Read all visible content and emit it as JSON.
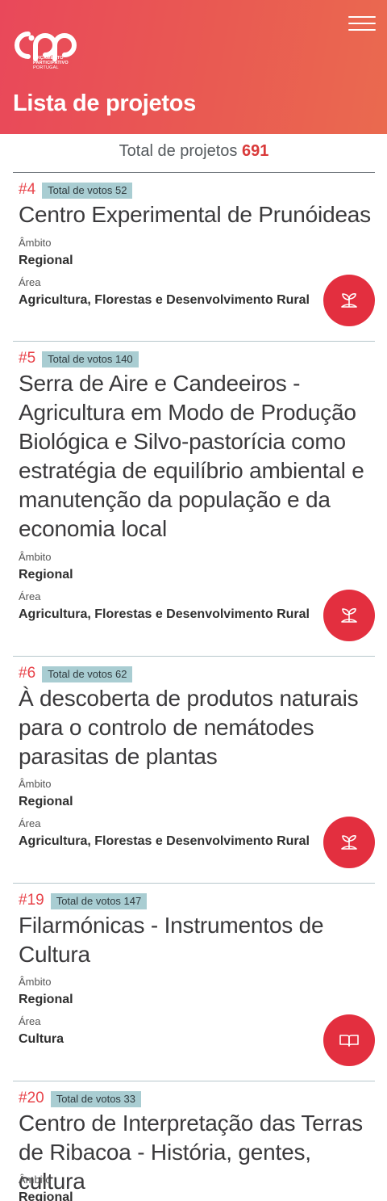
{
  "header": {
    "logo_lines": [
      "ORÇAMENTO",
      "PARTICIPATIVO"
    ],
    "logo_sub": "PORTUGAL",
    "title": "Lista de projetos",
    "menu_icon": "hamburger-icon",
    "logo_icon": "opp-logo"
  },
  "summary": {
    "label": "Total de projetos",
    "count": "691"
  },
  "labels": {
    "ambito": "Âmbito",
    "area": "Área"
  },
  "colors": {
    "accent": "#e32f3f",
    "votes_badge": "#a9cdd2",
    "header_gradient_start": "#e9485a",
    "header_gradient_end": "#ea6a4f"
  },
  "projects": [
    {
      "id": "#4",
      "votes": "Total de votos 52",
      "title_lines": [
        "Centro Experimental de Prunóideas"
      ],
      "ambito_label": "Âmbito",
      "ambito": "Regional",
      "area_label": "Área",
      "area": "Agricultura, Florestas e Desenvolvimento Rural",
      "icon": "sprout-icon"
    },
    {
      "id": "#5",
      "votes": "Total de votos 140",
      "title_lines": [
        "Serra de Aire e Candeeiros -",
        "Agricultura em Modo de Produção",
        "Biológica e Silvo-pastorícia como",
        "estratégia de equilíbrio ambiental e",
        "manutenção da população e da",
        "economia local"
      ],
      "ambito_label": "Âmbito",
      "ambito": "Regional",
      "area_label": "Área",
      "area": "Agricultura, Florestas e Desenvolvimento Rural",
      "icon": "sprout-icon"
    },
    {
      "id": "#6",
      "votes": "Total de votos 62",
      "title_lines": [
        "À descoberta de produtos naturais",
        "para o controlo de nemátodes",
        "parasitas de plantas"
      ],
      "ambito_label": "Âmbito",
      "ambito": "Regional",
      "area_label": "Área",
      "area": "Agricultura, Florestas e Desenvolvimento Rural",
      "icon": "sprout-icon"
    },
    {
      "id": "#19",
      "votes": "Total de votos 147",
      "title_lines": [
        "Filarmónicas - Instrumentos de",
        "Cultura"
      ],
      "ambito_label": "Âmbito",
      "ambito": "Regional",
      "area_label": "Área",
      "area": "Cultura",
      "icon": "book-icon"
    },
    {
      "id": "#20",
      "votes": "Total de votos 33",
      "title_lines": [
        "Centro de Interpretação das Terras",
        "de Ribacoa - História, gentes, cultura"
      ],
      "ambito_label": "Âmbito",
      "ambito": "Regional"
    }
  ]
}
